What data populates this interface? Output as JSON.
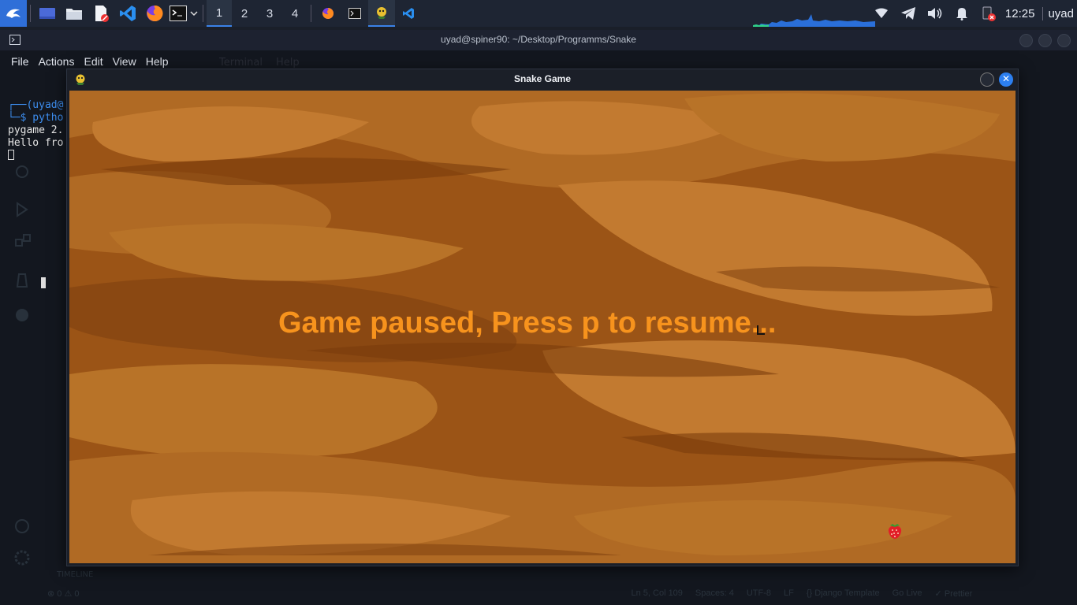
{
  "taskbar": {
    "workspaces": [
      "1",
      "2",
      "3",
      "4"
    ],
    "active_workspace": "1",
    "clock": "12:25",
    "user": "uyad"
  },
  "terminal": {
    "title": "uyad@spiner90: ~/Desktop/Programms/Snake",
    "menu": [
      "File",
      "Actions",
      "Edit",
      "View",
      "Help"
    ],
    "lines": {
      "prompt": "┌──(uyad@",
      "command": "└─$ pytho",
      "out1": "pygame 2.",
      "out2": "Hello fro"
    }
  },
  "ghost": {
    "menu_terminal": "Terminal",
    "menu_help": "Help",
    "timeline": "TIMELINE",
    "status_items": [
      "⊗ 0 ⚠ 0",
      "Ln 5, Col 109",
      "Spaces: 4",
      "UTF-8",
      "LF",
      "{} Django Template",
      "Go Live",
      "✓ Prettier"
    ]
  },
  "game": {
    "title": "Snake Game",
    "pause_message": "Game paused, Press p to resume...",
    "text_color": "#f7931d",
    "background_color": "#9b5416"
  },
  "colors": {
    "taskbar_bg": "#1e2533",
    "accent": "#3a82e8",
    "terminal_bg": "#13171f"
  }
}
